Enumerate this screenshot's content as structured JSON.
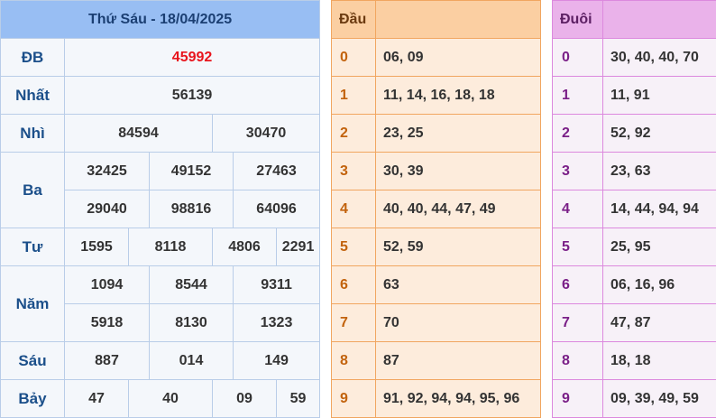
{
  "results": {
    "title": "Thứ Sáu - 18/04/2025",
    "db": {
      "label": "ĐB",
      "value": "45992"
    },
    "nhat": {
      "label": "Nhất",
      "value": "56139"
    },
    "nhi": {
      "label": "Nhì",
      "values": [
        "84594",
        "30470"
      ]
    },
    "ba": {
      "label": "Ba",
      "values": [
        "32425",
        "49152",
        "27463",
        "29040",
        "98816",
        "64096"
      ]
    },
    "tu": {
      "label": "Tư",
      "values": [
        "1595",
        "8118",
        "4806",
        "2291"
      ]
    },
    "nam": {
      "label": "Năm",
      "values": [
        "1094",
        "8544",
        "9311",
        "5918",
        "8130",
        "1323"
      ]
    },
    "sau": {
      "label": "Sáu",
      "values": [
        "887",
        "014",
        "149"
      ]
    },
    "bay": {
      "label": "Bảy",
      "values": [
        "47",
        "40",
        "09",
        "59"
      ]
    }
  },
  "dau": {
    "header": "Đầu",
    "rows": [
      {
        "key": "0",
        "value": "06, 09"
      },
      {
        "key": "1",
        "value": "11, 14, 16, 18, 18"
      },
      {
        "key": "2",
        "value": "23, 25"
      },
      {
        "key": "3",
        "value": "30, 39"
      },
      {
        "key": "4",
        "value": "40, 40, 44, 47, 49"
      },
      {
        "key": "5",
        "value": "52, 59"
      },
      {
        "key": "6",
        "value": "63"
      },
      {
        "key": "7",
        "value": "70"
      },
      {
        "key": "8",
        "value": "87"
      },
      {
        "key": "9",
        "value": "91, 92, 94, 94, 95, 96"
      }
    ]
  },
  "duoi": {
    "header": "Đuôi",
    "rows": [
      {
        "key": "0",
        "value": "30, 40, 40, 70"
      },
      {
        "key": "1",
        "value": "11, 91"
      },
      {
        "key": "2",
        "value": "52, 92"
      },
      {
        "key": "3",
        "value": "23, 63"
      },
      {
        "key": "4",
        "value": "14, 44, 94, 94"
      },
      {
        "key": "5",
        "value": "25, 95"
      },
      {
        "key": "6",
        "value": "06, 16, 96"
      },
      {
        "key": "7",
        "value": "47, 87"
      },
      {
        "key": "8",
        "value": "18, 18"
      },
      {
        "key": "9",
        "value": "09, 39, 49, 59"
      }
    ]
  },
  "colors": {
    "results_header": "#98bef3",
    "special_prize": "#e8141c",
    "dau_header": "#fbcfa2",
    "duoi_header": "#eab2ea"
  }
}
